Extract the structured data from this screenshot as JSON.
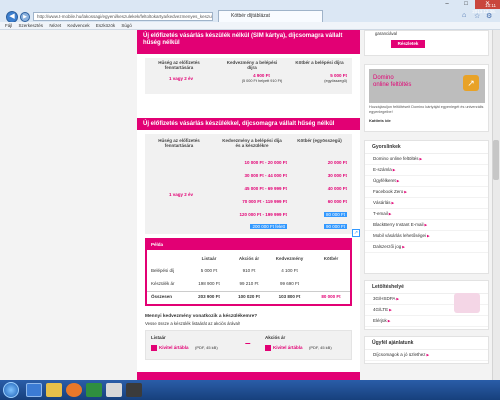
{
  "browser": {
    "address": "http://www.t-mobile.hu/lakossagi/egyeni/keszulekek/feltoltokartya/kedvezmenyes_keszulekek",
    "tab_title": "Kötbér díjtáblázat",
    "menu": [
      "Fájl",
      "Szerkesztés",
      "Nézet",
      "Kedvencek",
      "Eszközök",
      "Súgó"
    ],
    "window_buttons": [
      "–",
      "□",
      "✕"
    ],
    "right_icons": [
      "⌂",
      "☆",
      "⚙"
    ]
  },
  "section1": {
    "title": "Új előfizetés vásárlás készülék nélkül (SIM kártya), díjcsomagra vállalt hűség nélkül",
    "col1": "Hűség az előfizetés fenntartására",
    "col2": "Kedvezmény a belépési díjra",
    "col3": "Kötbér a belépési díjra",
    "row_period": "1 vagy 2 év",
    "row_discount": "4 900 Ft",
    "row_discount_note": "(5 000 Ft helyett 910 Ft)",
    "row_penalty": "5 000 Ft",
    "row_penalty_note": "(egyösszegű)"
  },
  "section2": {
    "title": "Új előfizetés vásárlás készülékkel, díjcsomagra vállalt hűség nélkül",
    "col1": "Hűség az előfizetés fenntartására",
    "col2": "Kedvezmény a belépési díja és a készülékre",
    "col3": "Kötbér (egyösszegű)",
    "period": "1 vagy 2 év",
    "rows": [
      {
        "range": "10 000 Ft - 20 000 Ft",
        "penalty": "20 000 Ft"
      },
      {
        "range": "30 000 Ft - 44 000 Ft",
        "penalty": "30 000 Ft"
      },
      {
        "range": "45 000 Ft - 69 999 Ft",
        "penalty": "40 000 Ft"
      },
      {
        "range": "70 000 Ft - 119 999 Ft",
        "penalty": "60 000 Ft"
      },
      {
        "range": "120 000 Ft - 199 999 Ft",
        "penalty": "80 000 Ft"
      },
      {
        "range": "200 000 Ft felett",
        "penalty": "90 000 Ft"
      }
    ]
  },
  "example": {
    "title": "Példa",
    "headers": [
      "Listaár",
      "Akciós ár",
      "Kedvezmény",
      "Kötbér"
    ],
    "rows": [
      {
        "label": "Belépési díj",
        "values": [
          "5 000 Ft",
          "910 Ft",
          "4 100 Ft",
          ""
        ]
      },
      {
        "label": "Készülék ár",
        "values": [
          "198 900 Ft",
          "99 210 Ft",
          "99 690 Ft",
          ""
        ]
      },
      {
        "label": "Összesen",
        "values": [
          "203 900 Ft",
          "100 020 Ft",
          "103 800 Ft",
          "80 000 Ft"
        ]
      }
    ]
  },
  "question": {
    "heading": "Mennyi kedvezmény vonatkozik a készülékemre?",
    "subtext": "Vesse össze a készülék listaárát az akciós árával!",
    "list_label": "Listaár",
    "sale_label": "Akciós ár",
    "link_text": "Kivitel ártábla",
    "link_meta": "(PDF, 45 kB)",
    "separator": "–"
  },
  "sidebar": {
    "top_text": "garanciával",
    "top_button": "Részletek",
    "promo_line1": "Domino",
    "promo_line2": "online feltöltés",
    "promo_text": "Hozzájáruljon feltöltéseit Domino kártyáját egyenlegét és univerzális egyenlegeibe!",
    "promo_link": "Kattints ide",
    "useful_title": "Gyorslinkek",
    "useful_links": [
      "Domino online feltöltés",
      "E-számla",
      "Ügyfélkeret",
      "Facebook Zero",
      "Vásárlás",
      "T-email",
      "BlackBerry Instant E-mail",
      "Mobil vásárlás lehetőségei",
      "Dalszerzői jog"
    ],
    "downloads_title": "Letöltéshelyé",
    "downloads": [
      "3G/HSDPA",
      "4G/LTE",
      "Elérjük"
    ],
    "clients_title": "Ügyfél ajánlatunk",
    "clients_link": "Díjcsomagok a jó üzlethez"
  },
  "taskbar": {
    "time": "10:11",
    "date": "2013.12.26."
  }
}
